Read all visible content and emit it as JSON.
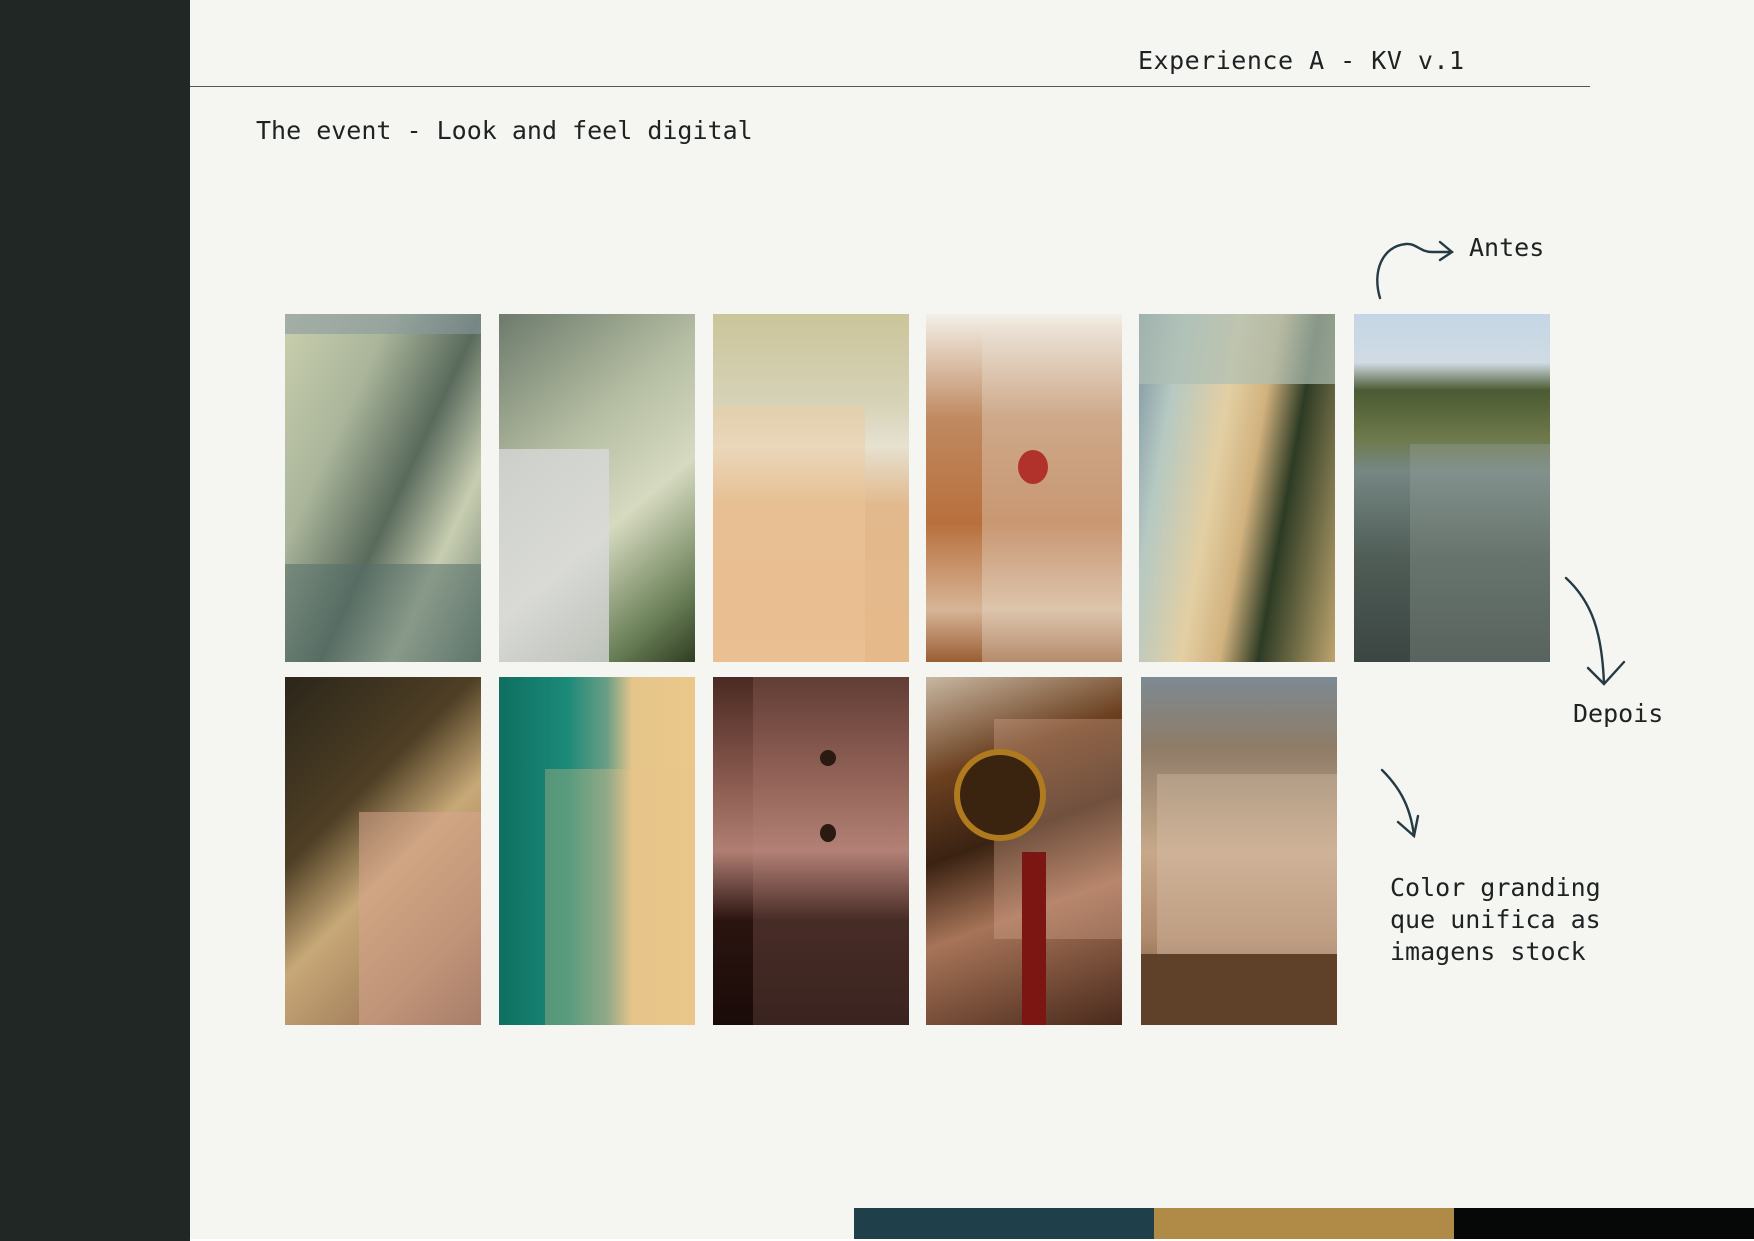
{
  "header": {
    "title": "Experience A - KV v.1"
  },
  "page": {
    "title": "The event - Look and feel digital"
  },
  "annotations": {
    "before": "Antes",
    "after": "Depois",
    "note_lines": [
      "Color granding",
      "que unifica as",
      "imagens stock"
    ]
  },
  "images": {
    "row1": [
      "palm-leaf-shadow",
      "palm-plant-shadow",
      "aerial-beach-waves",
      "ladybug-on-wheat",
      "aerial-coast-cliffs",
      "birds-over-lake"
    ],
    "row2": [
      "sand-dune",
      "aerial-beach-horses",
      "water-droplet",
      "wine-pouring",
      "wine-glasses-on-table"
    ]
  },
  "palette": {
    "sidebar": "#212725",
    "background": "#f5f5f1",
    "swatches": [
      "#1f3f4a",
      "#b08a47",
      "#060808"
    ]
  }
}
